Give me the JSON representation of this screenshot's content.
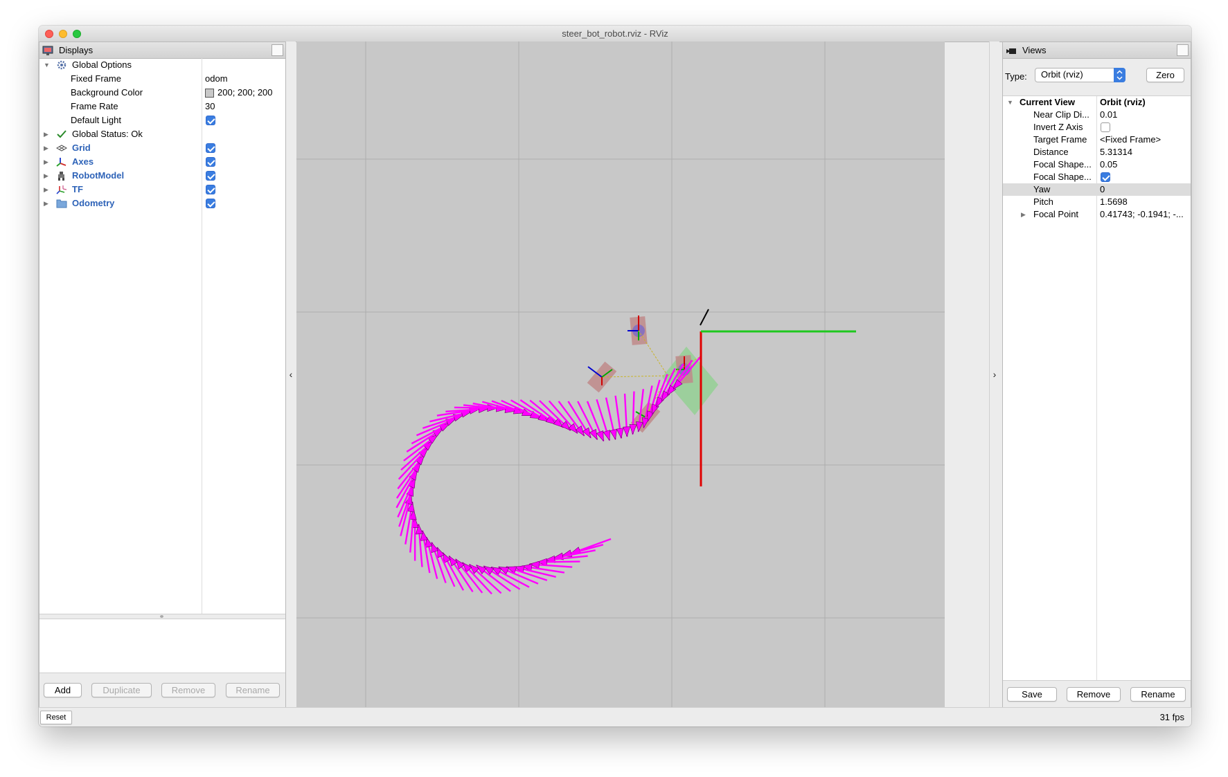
{
  "window": {
    "title": "steer_bot_robot.rviz - RViz"
  },
  "displays_panel": {
    "title": "Displays",
    "global_options": {
      "label": "Global Options",
      "fixed_frame_label": "Fixed Frame",
      "fixed_frame_value": "odom",
      "background_color_label": "Background Color",
      "background_color_value": "200; 200; 200",
      "background_color_swatch": "#c8c8c8",
      "frame_rate_label": "Frame Rate",
      "frame_rate_value": "30",
      "default_light_label": "Default Light",
      "default_light_checked": true
    },
    "global_status": {
      "label": "Global Status: Ok"
    },
    "displays": [
      {
        "label": "Grid",
        "icon": "grid-icon",
        "checked": true
      },
      {
        "label": "Axes",
        "icon": "axes-icon",
        "checked": true
      },
      {
        "label": "RobotModel",
        "icon": "robot-model-icon",
        "checked": true
      },
      {
        "label": "TF",
        "icon": "tf-icon",
        "checked": true
      },
      {
        "label": "Odometry",
        "icon": "folder-icon",
        "checked": true
      }
    ],
    "buttons": {
      "add": "Add",
      "duplicate": "Duplicate",
      "remove": "Remove",
      "rename": "Rename"
    }
  },
  "views_panel": {
    "title": "Views",
    "type_label": "Type:",
    "type_value": "Orbit (rviz)",
    "zero_button": "Zero",
    "current_view_label": "Current View",
    "current_view_value": "Orbit (rviz)",
    "properties": [
      {
        "label": "Near Clip Di...",
        "value": "0.01"
      },
      {
        "label": "Invert Z Axis",
        "checkbox": false
      },
      {
        "label": "Target Frame",
        "value": "<Fixed Frame>"
      },
      {
        "label": "Distance",
        "value": "5.31314"
      },
      {
        "label": "Focal Shape...",
        "value": "0.05"
      },
      {
        "label": "Focal Shape...",
        "checkbox": true
      },
      {
        "label": "Yaw",
        "value": "0",
        "selected": true
      },
      {
        "label": "Pitch",
        "value": "1.5698"
      },
      {
        "label": "Focal Point",
        "value": "0.41743; -0.1941; -...",
        "expandable": true
      }
    ],
    "buttons": {
      "save": "Save",
      "remove": "Remove",
      "rename": "Rename"
    }
  },
  "viewport": {
    "background_color": "#c8c8c8",
    "grid_color": "#aeaeae",
    "arrow_color": "#ff00ff",
    "axis_x_color": "#ff0000",
    "axis_y_color": "#00cc00",
    "left_handle": "‹",
    "right_handle": "›"
  },
  "statusbar": {
    "reset_button": "Reset",
    "fps": "31 fps"
  }
}
